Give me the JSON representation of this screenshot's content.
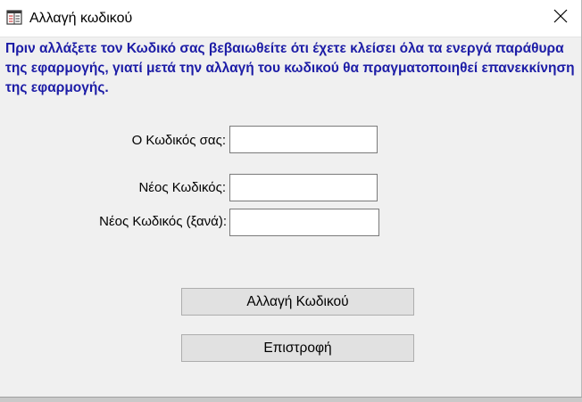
{
  "window": {
    "title": "Αλλαγή κωδικού",
    "title_icon": "app-form-icon",
    "close_icon": "close-icon"
  },
  "info": {
    "message": "Πριν αλλάξετε τον Κωδικό σας βεβαιωθείτε ότι έχετε κλείσει όλα τα ενεργά παράθυρα της εφαρμογής, γιατί μετά την αλλαγή του κωδικού θα πραγματοποιηθεί επανεκκίνηση της εφαρμογής.",
    "color": "#1c1ca6"
  },
  "form": {
    "current_password_label": "Ο Κωδικός σας:",
    "current_password_value": "",
    "new_password_label": "Νέος Κωδικός:",
    "new_password_value": "",
    "confirm_password_label": "Νέος Κωδικός (ξανά):",
    "confirm_password_value": ""
  },
  "buttons": {
    "change_password": "Αλλαγή Κωδικού",
    "back": "Επιστροφή"
  }
}
